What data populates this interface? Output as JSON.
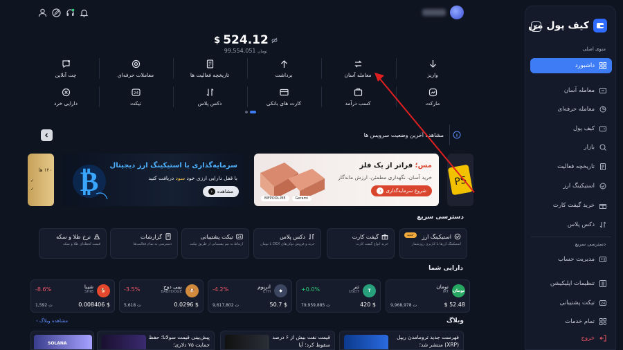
{
  "app": {
    "brand": "کیف پول من",
    "user_name_blurred": "●●●●●"
  },
  "colors": {
    "bg": "#0f1421",
    "accent": "#3d7cf5",
    "positive": "#2fd07a",
    "negative": "#f25767",
    "annotation": "#e02020"
  },
  "sidebar": {
    "main_menu_label": "منوی اصلی",
    "items": [
      {
        "label": "داشبورد",
        "icon": "grid-icon",
        "active": true
      },
      {
        "label": "معامله آسان",
        "icon": "swap-icon"
      },
      {
        "label": "معامله حرفه‌ای",
        "icon": "chart-icon"
      },
      {
        "label": "کیف پول",
        "icon": "wallet-icon"
      },
      {
        "label": "بازار",
        "icon": "market-icon"
      },
      {
        "label": "تاریخچه فعالیت",
        "icon": "history-icon"
      },
      {
        "label": "استیکینگ ارز",
        "icon": "staking-icon"
      },
      {
        "label": "خرید گیفت کارت",
        "icon": "gift-icon"
      },
      {
        "label": "دکس پلاس",
        "icon": "dex-icon"
      }
    ],
    "quick_access_label": "دسترسی سریع",
    "quick_items": [
      {
        "label": "مدیریت حساب",
        "icon": "account-icon"
      },
      {
        "label": "تنظیمات اپلیکیشن",
        "icon": "settings-icon"
      },
      {
        "label": "تیکت پشتیبانی",
        "icon": "ticket-icon"
      },
      {
        "label": "تمام خدمات",
        "icon": "services-icon"
      },
      {
        "label": "خروج",
        "icon": "logout-icon"
      }
    ]
  },
  "balance": {
    "usd": "524.12",
    "usd_sign": "$",
    "toman": "99,554,051",
    "toman_unit": "تومان"
  },
  "actions_row1": [
    {
      "label": "واریز",
      "icon": "deposit-icon"
    },
    {
      "label": "معامله آسان",
      "icon": "swap-icon"
    },
    {
      "label": "برداشت",
      "icon": "withdraw-icon"
    },
    {
      "label": "تاریخچه فعالیت ها",
      "icon": "history-icon"
    },
    {
      "label": "معاملات حرفه‌ای",
      "icon": "trade-icon"
    },
    {
      "label": "چت آنلاین",
      "icon": "chat-icon"
    }
  ],
  "actions_row2": [
    {
      "label": "مارکت",
      "icon": "market-icon"
    },
    {
      "label": "کسب درآمد",
      "icon": "earn-icon"
    },
    {
      "label": "کارت های بانکی",
      "icon": "card-icon"
    },
    {
      "label": "دکس پلاس",
      "icon": "dex-icon"
    },
    {
      "label": "تیکت",
      "icon": "ticket-icon"
    },
    {
      "label": "دارایی خرد",
      "icon": "dust-icon"
    }
  ],
  "status": {
    "text": "مشاهده آخرین وضعیت سرویس ها"
  },
  "banners": {
    "crypto": {
      "title": "سرمایه‌گذاری با استیکینگ ارز دیجیتال",
      "sub_pre": "با قفل دارایی ارزی خود ",
      "sub_highlight": "سود",
      "sub_post": " دریافت کنید",
      "button": "مشاهده"
    },
    "metal": {
      "title_pre": "مس؛ ",
      "title_post": "فراتر از یک فلز",
      "sub": "خرید آسان، نگهداری مطمئن، ارزش ماندگار",
      "button": "شروع سرمایه‌گذاری",
      "tag1": "BIFPOOL.ME",
      "tag2": "Gerami"
    },
    "left_partial": {
      "line1": "۱۲۰ ها",
      "line2": "✓",
      "line3": "✓"
    }
  },
  "quick_access": {
    "title": "دسترسی سریع",
    "cards": [
      {
        "title": "استیکینگ ارز",
        "desc": "استیکینگ ارزها با کاربری روزشمار",
        "icon": "staking-icon",
        "tag": "جدید"
      },
      {
        "title": "گیفت کارت",
        "desc": "خرید انواع گیفت کارت",
        "icon": "gift-icon"
      },
      {
        "title": "دکس پلاس",
        "desc": "خرید و فروش توکن‌های DEX با تومان",
        "icon": "dex-icon"
      },
      {
        "title": "تیکت پشتیبانی",
        "desc": "ارتباط به تیم پشتیبانی از طریق تیکت",
        "icon": "ticket-icon"
      },
      {
        "title": "گزارشات",
        "desc": "دسترسی به تمام فعالیت‌ها",
        "icon": "report-icon"
      },
      {
        "title": "نرخ طلا و سکه",
        "desc": "قیمت لحظه‌ای طلا و سکه",
        "icon": "gold-icon"
      }
    ]
  },
  "assets": {
    "title": "دارایی شما",
    "items": [
      {
        "name": "تومان",
        "symbol": "IRT",
        "change": "",
        "value": "$ 52.48",
        "toman": "9,968,978 ت",
        "coin_label": "تومان",
        "coin_color": "#27a862"
      },
      {
        "name": "تتر",
        "symbol": "USDT",
        "change": "+0.0%",
        "value": "420 $",
        "toman": "79,959,885 ت",
        "coin_label": "T",
        "coin_color": "#26a17b"
      },
      {
        "name": "اتریوم",
        "symbol": "ETH",
        "change": "-4.2%",
        "value": "50.7 $",
        "toman": "9,617,802 ت",
        "coin_label": "◆",
        "coin_color": "#3c4660"
      },
      {
        "name": "بیبی دوج",
        "symbol": "BABYDOGE",
        "change": "-3.5%",
        "value": "0.0296 $",
        "toman": "5,618 ت",
        "coin_label": "🐶",
        "coin_color": "#d28a3c"
      },
      {
        "name": "شیبا",
        "symbol": "SHIB",
        "change": "-8.6%",
        "value": "0.008406 $",
        "toman": "1,592 ت",
        "coin_label": "🐕",
        "coin_color": "#e5482d"
      }
    ]
  },
  "blog": {
    "title": "وبلاگ",
    "view_all": "مشاهده وبلاگ ›",
    "posts": [
      {
        "title": "فهرست جدید ترومامدن ریپل (XRP) منتشر شد؛"
      },
      {
        "title": "قیمت نفت بیش از ۶ درصد سقوط کرد؛ آیا"
      },
      {
        "title": "پیش‌بینی قیمت سولانا؛ حفظ حمایت ۷۵ دلاری؛"
      },
      {
        "title": "SOLANA"
      }
    ]
  }
}
